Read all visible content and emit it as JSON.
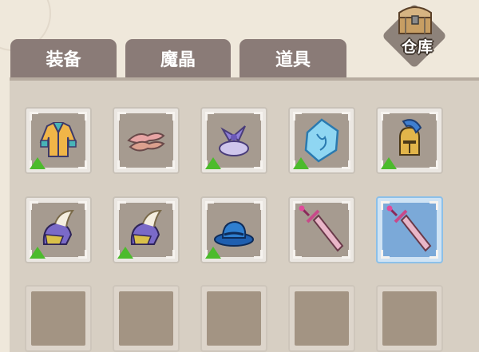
{
  "warehouse": {
    "label": "仓库",
    "icon": "treasure-chest-icon"
  },
  "tabs": [
    {
      "label": "装备",
      "active": true
    },
    {
      "label": "魔晶",
      "active": false
    },
    {
      "label": "道具",
      "active": false
    }
  ],
  "grid": {
    "rows": [
      [
        {
          "item": "jacket-armor",
          "upgrade": true
        },
        {
          "item": "pink-ribbon",
          "upgrade": false
        },
        {
          "item": "purple-bow-hat",
          "upgrade": true
        },
        {
          "item": "blue-crystal",
          "upgrade": true
        },
        {
          "item": "gold-helmet",
          "upgrade": true
        }
      ],
      [
        {
          "item": "white-plume-helmet",
          "upgrade": true
        },
        {
          "item": "white-plume-helmet",
          "upgrade": true
        },
        {
          "item": "blue-hat",
          "upgrade": true
        },
        {
          "item": "pink-sword",
          "upgrade": false
        },
        {
          "item": "pink-sword",
          "upgrade": false,
          "selected": true
        }
      ],
      [
        {
          "item": "empty"
        },
        {
          "item": "empty"
        },
        {
          "item": "empty"
        },
        {
          "item": "empty"
        },
        {
          "item": "empty"
        }
      ]
    ]
  },
  "colors": {
    "tab": "#8a7b77",
    "panel": "#d7cfc3",
    "slot_fill": "#a69b90",
    "upgrade_arrow": "#4cbb2c",
    "selected_slot": "#7ba9d8"
  }
}
